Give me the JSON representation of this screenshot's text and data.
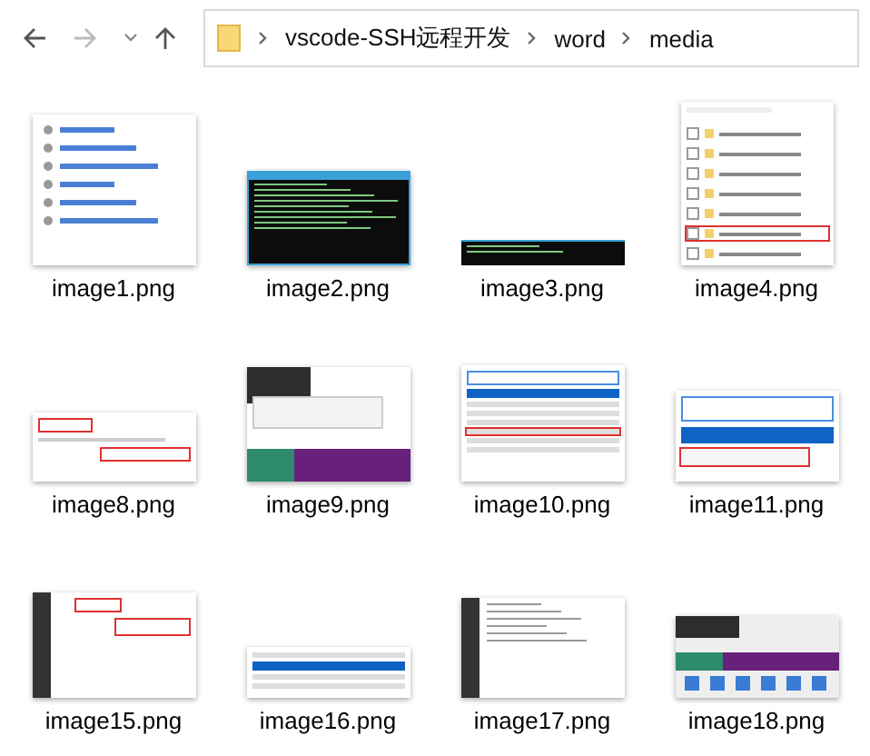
{
  "address_bar": {
    "path": [
      "vscode-SSH远程开发",
      "word",
      "media"
    ]
  },
  "files": [
    {
      "name": "image1.png",
      "kind": "link-list"
    },
    {
      "name": "image2.png",
      "kind": "terminal"
    },
    {
      "name": "image3.png",
      "kind": "terminal-strip"
    },
    {
      "name": "image4.png",
      "kind": "checklist"
    },
    {
      "name": "image8.png",
      "kind": "settings"
    },
    {
      "name": "image9.png",
      "kind": "tooltip"
    },
    {
      "name": "image10.png",
      "kind": "menu"
    },
    {
      "name": "image11.png",
      "kind": "ssh-menu"
    },
    {
      "name": "image15.png",
      "kind": "editor"
    },
    {
      "name": "image16.png",
      "kind": "picker"
    },
    {
      "name": "image17.png",
      "kind": "terminal-light"
    },
    {
      "name": "image18.png",
      "kind": "taskbar"
    }
  ]
}
